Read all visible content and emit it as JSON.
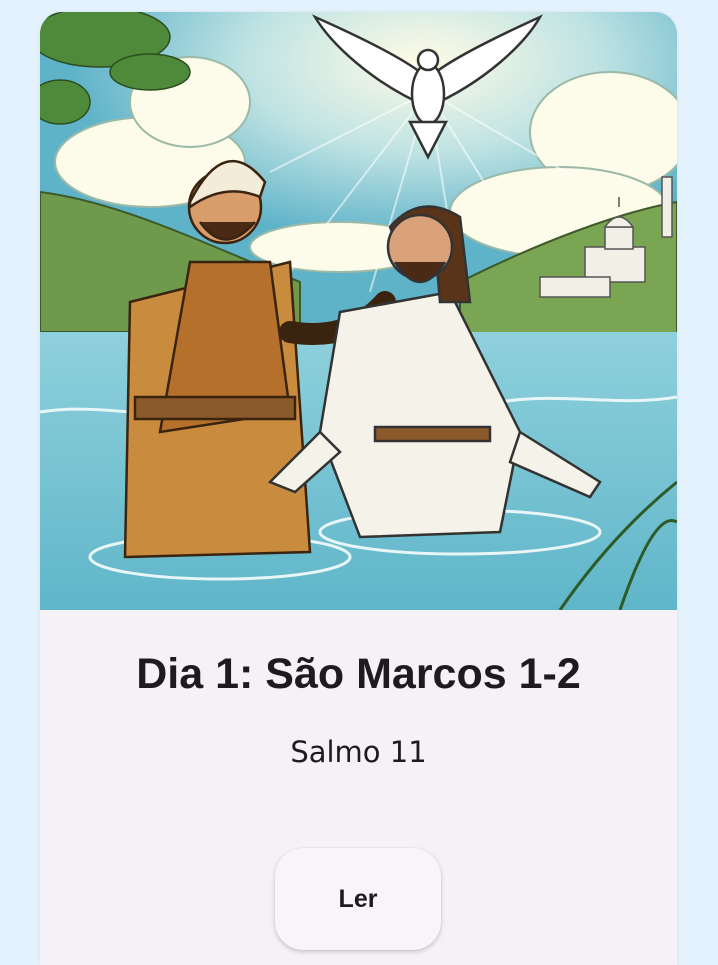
{
  "card": {
    "illustration_alt": "Baptism in the river",
    "title": "Dia 1: São Marcos 1-2",
    "subtitle": "Salmo 11",
    "read_button_label": "Ler"
  },
  "colors": {
    "page_background": "#e3f2fd",
    "card_background": "#f5f1f7",
    "text": "#1d1b20"
  }
}
